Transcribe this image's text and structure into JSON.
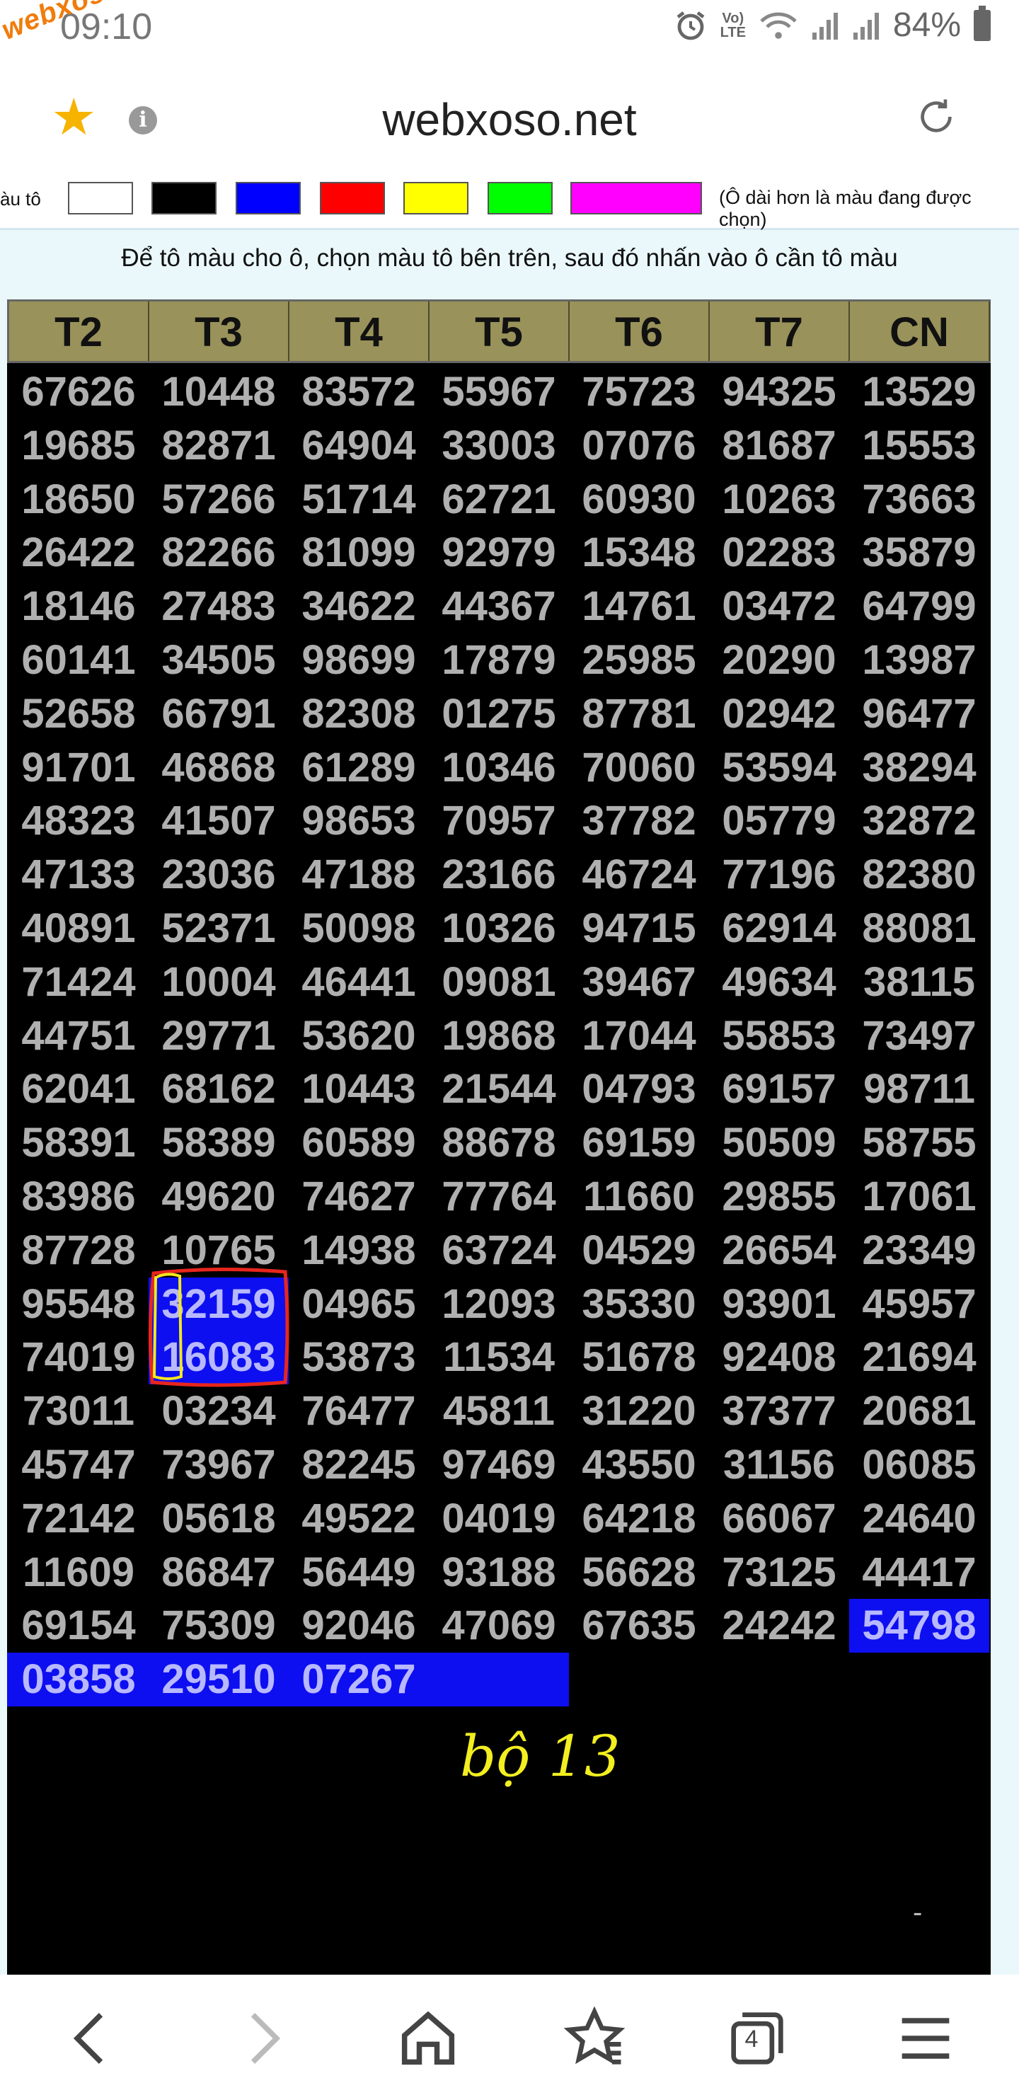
{
  "status_bar": {
    "time": "09:10",
    "watermark": "webxoso.net",
    "network_label": "VoLTE",
    "battery": "84%"
  },
  "browser": {
    "url": "webxoso.net",
    "tab_count": "4"
  },
  "color_picker": {
    "label": "àu tô",
    "note": "(Ô dài hơn là màu đang được chọn)",
    "swatches": [
      "#ffffff",
      "#000000",
      "#0000ff",
      "#ff0000",
      "#ffff00",
      "#00ff00",
      "#ff00ff"
    ],
    "selected": "#ff00ff"
  },
  "instruction": "Để tô màu cho ô, chọn màu tô bên trên, sau đó nhấn vào ô cần tô màu",
  "grid": {
    "headers": [
      "T2",
      "T3",
      "T4",
      "T5",
      "T6",
      "T7",
      "CN"
    ],
    "rows": [
      [
        "67626",
        "10448",
        "83572",
        "55967",
        "75723",
        "94325",
        "13529"
      ],
      [
        "19685",
        "82871",
        "64904",
        "33003",
        "07076",
        "81687",
        "15553"
      ],
      [
        "18650",
        "57266",
        "51714",
        "62721",
        "60930",
        "10263",
        "73663"
      ],
      [
        "26422",
        "82266",
        "81099",
        "92979",
        "15348",
        "02283",
        "35879"
      ],
      [
        "18146",
        "27483",
        "34622",
        "44367",
        "14761",
        "03472",
        "64799"
      ],
      [
        "60141",
        "34505",
        "98699",
        "17879",
        "25985",
        "20290",
        "13987"
      ],
      [
        "52658",
        "66791",
        "82308",
        "01275",
        "87781",
        "02942",
        "96477"
      ],
      [
        "91701",
        "46868",
        "61289",
        "10346",
        "70060",
        "53594",
        "38294"
      ],
      [
        "48323",
        "41507",
        "98653",
        "70957",
        "37782",
        "05779",
        "32872"
      ],
      [
        "47133",
        "23036",
        "47188",
        "23166",
        "46724",
        "77196",
        "82380"
      ],
      [
        "40891",
        "52371",
        "50098",
        "10326",
        "94715",
        "62914",
        "88081"
      ],
      [
        "71424",
        "10004",
        "46441",
        "09081",
        "39467",
        "49634",
        "38115"
      ],
      [
        "44751",
        "29771",
        "53620",
        "19868",
        "17044",
        "55853",
        "73497"
      ],
      [
        "62041",
        "68162",
        "10443",
        "21544",
        "04793",
        "69157",
        "98711"
      ],
      [
        "58391",
        "58389",
        "60589",
        "88678",
        "69159",
        "50509",
        "58755"
      ],
      [
        "83986",
        "49620",
        "74627",
        "77764",
        "11660",
        "29855",
        "17061"
      ],
      [
        "87728",
        "10765",
        "14938",
        "63724",
        "04529",
        "26654",
        "23349"
      ],
      [
        "95548",
        "32159",
        "04965",
        "12093",
        "35330",
        "93901",
        "45957"
      ],
      [
        "74019",
        "16083",
        "53873",
        "11534",
        "51678",
        "92408",
        "21694"
      ],
      [
        "73011",
        "03234",
        "76477",
        "45811",
        "31220",
        "37377",
        "20681"
      ],
      [
        "45747",
        "73967",
        "82245",
        "97469",
        "43550",
        "31156",
        "06085"
      ],
      [
        "72142",
        "05618",
        "49522",
        "04019",
        "64218",
        "66067",
        "24640"
      ],
      [
        "11609",
        "86847",
        "56449",
        "93188",
        "56628",
        "73125",
        "44417"
      ],
      [
        "69154",
        "75309",
        "92046",
        "47069",
        "67635",
        "24242",
        "54798"
      ],
      [
        "03858",
        "29510",
        "07267",
        "",
        "",
        "",
        ""
      ]
    ],
    "highlight_color": "#0d0ff0"
  },
  "handwritten_note": "bộ 13",
  "footer_mark": "-"
}
